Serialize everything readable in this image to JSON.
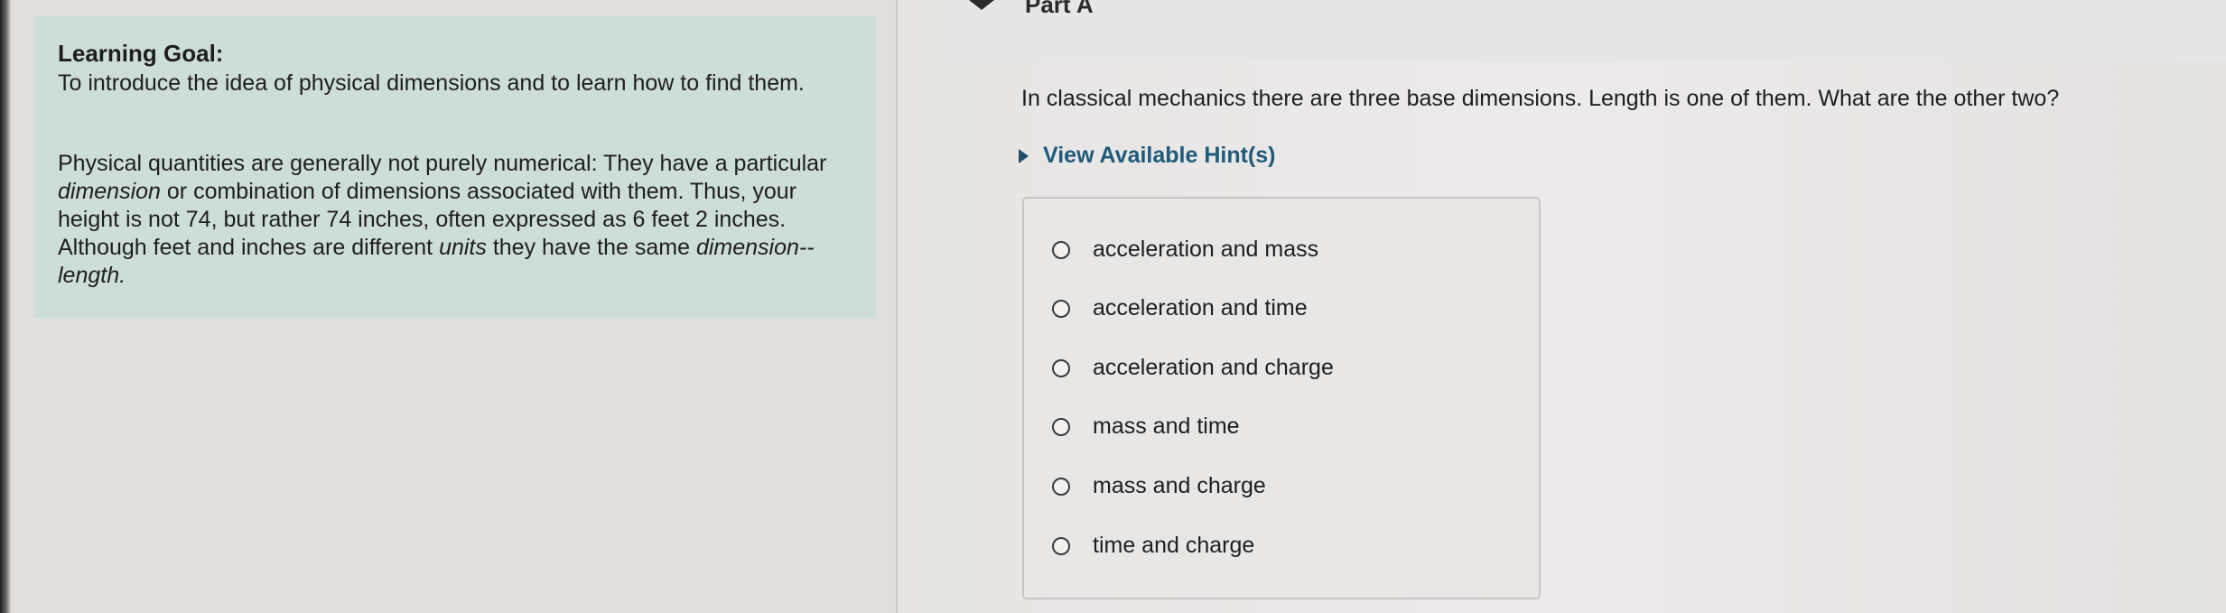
{
  "learning_goal": {
    "title": "Learning Goal:",
    "intro": "To introduce the idea of physical dimensions and to learn how to find them.",
    "body_parts": [
      "Physical quantities are generally not purely numerical: They have a particular ",
      "dimension",
      " or combination of dimensions associated with them. Thus, your height is not 74, but rather 74 inches, often expressed as 6 feet 2 inches. Although feet and inches are different ",
      "units",
      " they have the same ",
      "dimension--length."
    ]
  },
  "part": {
    "title": "Part A"
  },
  "question": {
    "text": "In classical mechanics there are three base dimensions. Length is one of them. What are the other two?",
    "hint_label": "View Available Hint(s)",
    "choices": [
      "acceleration and mass",
      "acceleration and time",
      "acceleration and charge",
      "mass and time",
      "mass and charge",
      "time and charge"
    ]
  },
  "colors": {
    "goal_background": "#cdddd8",
    "hint_link": "#1f5a7a",
    "page_background": "#e6e5e4"
  },
  "icons": {
    "part_toggle": "chevron-down-icon",
    "hint_toggle": "caret-right-icon",
    "choice_marker": "radio-icon"
  }
}
